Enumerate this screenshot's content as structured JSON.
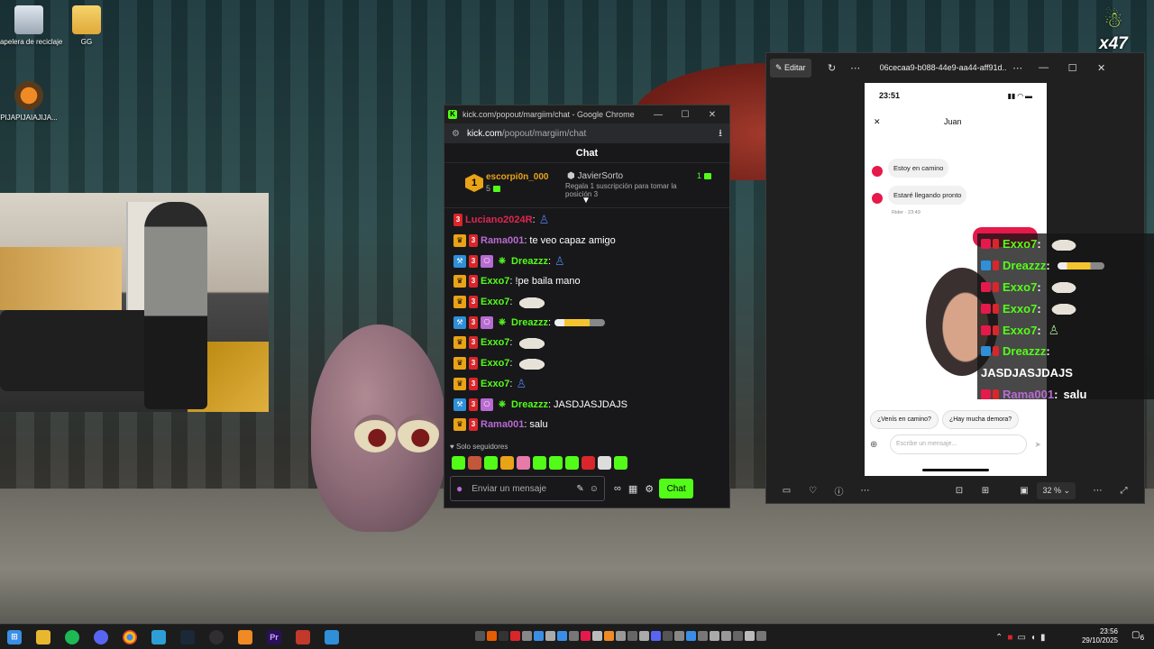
{
  "desktop": {
    "icons": [
      {
        "label": "Papelera de reciclaje"
      },
      {
        "label": "GG"
      },
      {
        "label": "PIJAPIJAIAJIJA..."
      }
    ],
    "overlay_logo": "x47"
  },
  "chrome": {
    "title": "kick.com/popout/margiim/chat - Google Chrome",
    "url_domain": "kick.com",
    "url_path": "/popout/margiim/chat",
    "chat_header": "Chat",
    "leaderboard": {
      "rank": "1",
      "top_user": "escorpi0n_000",
      "top_count": "5",
      "second_user": "JavierSorto",
      "second_count": "1",
      "description": "Regala 1 suscripción para tomar la posición 3"
    },
    "messages": [
      {
        "user": "Luciano2024R",
        "color": "#e0264f",
        "text": "",
        "badges": [
          "sub"
        ],
        "emote": "figure"
      },
      {
        "user": "Rama001",
        "color": "#b86bd1",
        "text": "te veo capaz amigo",
        "badges": [
          "crown",
          "sub"
        ],
        "emote": ""
      },
      {
        "user": "Dreazzz",
        "color": "#53fc18",
        "text": "",
        "badges": [
          "mod",
          "sub",
          "gift",
          "drop"
        ],
        "emote": "figure"
      },
      {
        "user": "Exxo7",
        "color": "#53fc18",
        "text": "!pe baila mano",
        "badges": [
          "crown",
          "sub"
        ],
        "emote": ""
      },
      {
        "user": "Exxo7",
        "color": "#53fc18",
        "text": "",
        "badges": [
          "crown",
          "sub"
        ],
        "emote": "cat"
      },
      {
        "user": "Dreazzz",
        "color": "#53fc18",
        "text": "",
        "badges": [
          "mod",
          "sub",
          "gift",
          "drop"
        ],
        "emote": "pen"
      },
      {
        "user": "Exxo7",
        "color": "#53fc18",
        "text": "",
        "badges": [
          "crown",
          "sub"
        ],
        "emote": "cat"
      },
      {
        "user": "Exxo7",
        "color": "#53fc18",
        "text": "",
        "badges": [
          "crown",
          "sub"
        ],
        "emote": "cat"
      },
      {
        "user": "Exxo7",
        "color": "#53fc18",
        "text": "",
        "badges": [
          "crown",
          "sub"
        ],
        "emote": "figure"
      },
      {
        "user": "Dreazzz",
        "color": "#53fc18",
        "text": "JASDJASJDAJS",
        "badges": [
          "mod",
          "sub",
          "gift",
          "drop"
        ],
        "emote": ""
      },
      {
        "user": "Rama001",
        "color": "#b86bd1",
        "text": "salu",
        "badges": [
          "crown",
          "sub"
        ],
        "emote": ""
      }
    ],
    "followers_only": "Solo seguidores",
    "input_placeholder": "Enviar un mensaje",
    "send_label": "Chat"
  },
  "photos": {
    "edit_label": "Editar",
    "filename": "06cecaa9-b088-44e9-aa44-aff91d...",
    "zoom": "32 %",
    "phone": {
      "time": "23:51",
      "contact": "Juan",
      "bubble1": "Estoy en camino",
      "bubble2": "Estaré llegando pronto",
      "rider_time": "Rider · 23:49",
      "chip1": "¿Venís en camino?",
      "chip2": "¿Hay mucha demora?",
      "input_placeholder": "Escribe un mensaje..."
    }
  },
  "stream_overlay": {
    "rows": [
      {
        "user": "Exxo7",
        "color": "#53fc18",
        "text": "",
        "emote": "cat",
        "badges": [
          "heart",
          "sub"
        ]
      },
      {
        "user": "Dreazzz",
        "color": "#53fc18",
        "text": "",
        "emote": "pen",
        "badges": [
          "mod",
          "sub"
        ]
      },
      {
        "user": "Exxo7",
        "color": "#53fc18",
        "text": "",
        "emote": "cat",
        "badges": [
          "heart",
          "sub"
        ]
      },
      {
        "user": "Exxo7",
        "color": "#53fc18",
        "text": "",
        "emote": "cat",
        "badges": [
          "heart",
          "sub"
        ]
      },
      {
        "user": "Exxo7",
        "color": "#53fc18",
        "text": "",
        "emote": "figure",
        "badges": [
          "heart",
          "sub"
        ]
      },
      {
        "user": "Dreazzz",
        "color": "#53fc18",
        "text": "",
        "emote": "",
        "badges": [
          "mod",
          "sub"
        ]
      },
      {
        "user": "",
        "color": "#ffffff",
        "text": "JASDJASJDAJS",
        "emote": "",
        "badges": []
      },
      {
        "user": "Rama001",
        "color": "#b86bd1",
        "text": "salu",
        "emote": "",
        "badges": [
          "heart",
          "sub"
        ]
      }
    ]
  },
  "taskbar": {
    "time": "23:56",
    "date": "29/10/2025",
    "notifications": "6"
  },
  "colors": {
    "kick_green": "#53fc18",
    "sub_red": "#d9262b",
    "crown_gold": "#e8a317",
    "mod_blue": "#2f8fd8"
  }
}
